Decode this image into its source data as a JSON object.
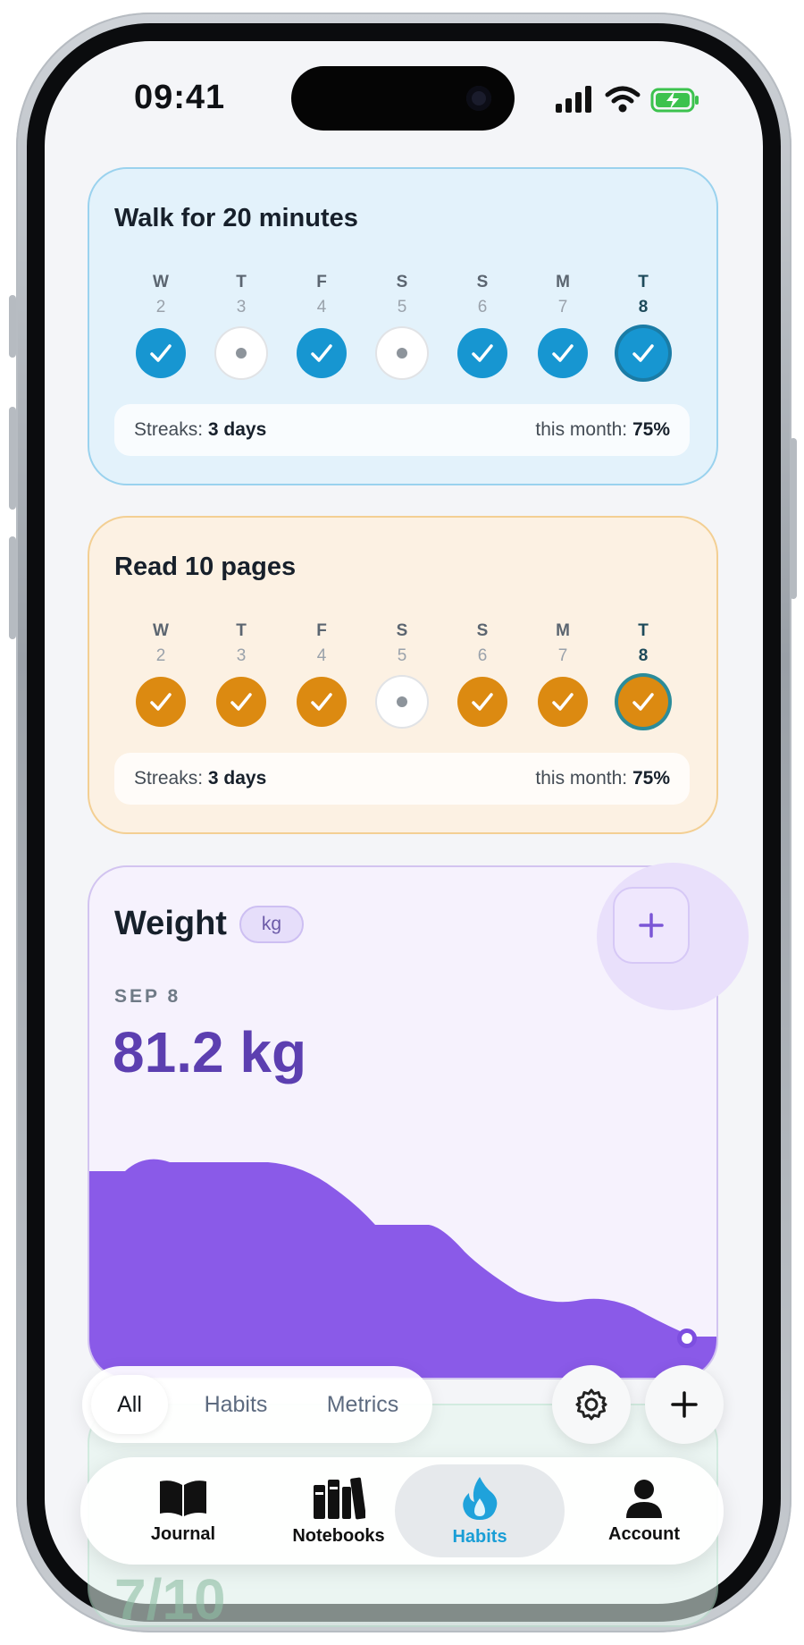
{
  "status_bar": {
    "time": "09:41"
  },
  "habits": [
    {
      "title": "Walk for 20 minutes",
      "theme": "blue",
      "days": [
        {
          "letter": "W",
          "num": "2",
          "state": "done"
        },
        {
          "letter": "T",
          "num": "3",
          "state": "empty"
        },
        {
          "letter": "F",
          "num": "4",
          "state": "done"
        },
        {
          "letter": "S",
          "num": "5",
          "state": "empty"
        },
        {
          "letter": "S",
          "num": "6",
          "state": "done"
        },
        {
          "letter": "M",
          "num": "7",
          "state": "done"
        },
        {
          "letter": "T",
          "num": "8",
          "state": "today-done"
        }
      ],
      "streak_label": "Streaks:",
      "streak_value": "3 days",
      "month_label": "this month:",
      "month_value": "75%"
    },
    {
      "title": "Read 10 pages",
      "theme": "amber",
      "days": [
        {
          "letter": "W",
          "num": "2",
          "state": "done"
        },
        {
          "letter": "T",
          "num": "3",
          "state": "done"
        },
        {
          "letter": "F",
          "num": "4",
          "state": "done"
        },
        {
          "letter": "S",
          "num": "5",
          "state": "empty"
        },
        {
          "letter": "S",
          "num": "6",
          "state": "done"
        },
        {
          "letter": "M",
          "num": "7",
          "state": "done"
        },
        {
          "letter": "T",
          "num": "8",
          "state": "today-done"
        }
      ],
      "streak_label": "Streaks:",
      "streak_value": "3 days",
      "month_label": "this month:",
      "month_value": "75%"
    }
  ],
  "weight": {
    "title": "Weight",
    "unit": "kg",
    "date": "SEP 8",
    "value": "81.2 kg",
    "add_icon": "plus-icon"
  },
  "hidden_card": {
    "value": "7/10"
  },
  "filters": {
    "items": [
      "All",
      "Habits",
      "Metrics"
    ],
    "active": "All"
  },
  "actions": {
    "settings_icon": "gear-icon",
    "add_icon": "plus-icon"
  },
  "tabbar": {
    "items": [
      {
        "label": "Journal",
        "icon": "book-icon"
      },
      {
        "label": "Notebooks",
        "icon": "notebooks-icon"
      },
      {
        "label": "Habits",
        "icon": "flame-icon",
        "active": true
      },
      {
        "label": "Account",
        "icon": "person-icon"
      }
    ]
  },
  "colors": {
    "blue_done": "#1796d1",
    "amber_done": "#dc8a11",
    "weight_accent": "#8a5ae8",
    "weight_text": "#5c3fb0",
    "habits_active": "#1a9ed6"
  }
}
